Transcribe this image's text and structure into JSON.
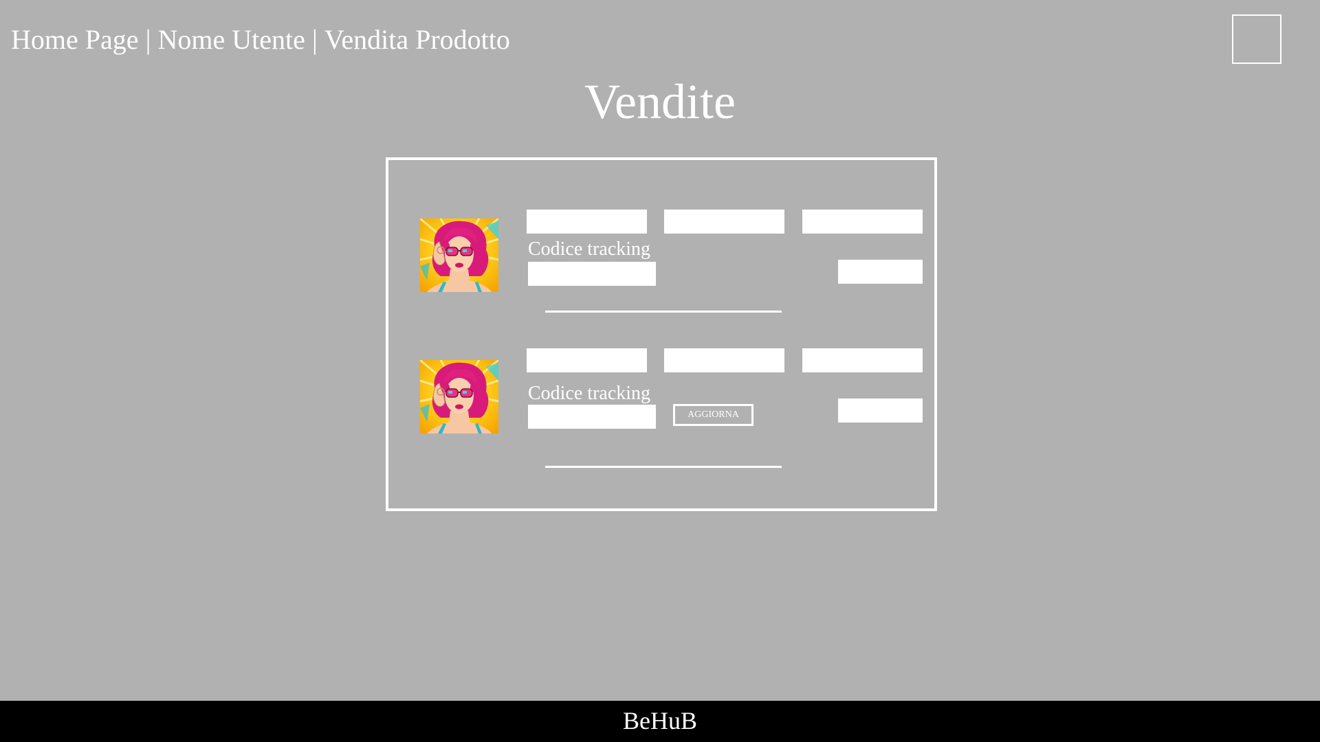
{
  "header": {
    "breadcrumb": [
      {
        "label": "Home Page"
      },
      {
        "label": "Nome Utente"
      },
      {
        "label": "Vendita Prodotto"
      }
    ],
    "separator": "|"
  },
  "page_title": "Vendite",
  "sales": [
    {
      "avatar_icon": "pop-art-woman-sunglasses-avatar",
      "tracking_label": "Codice tracking",
      "has_update_button": false
    },
    {
      "avatar_icon": "pop-art-woman-sunglasses-avatar",
      "tracking_label": "Codice tracking",
      "has_update_button": true,
      "update_label": "AGGIORNA"
    }
  ],
  "footer": {
    "brand": "BeHuB"
  },
  "colors": {
    "background": "#b1b1b1",
    "foreground": "#ffffff",
    "footer_bg": "#000000"
  }
}
